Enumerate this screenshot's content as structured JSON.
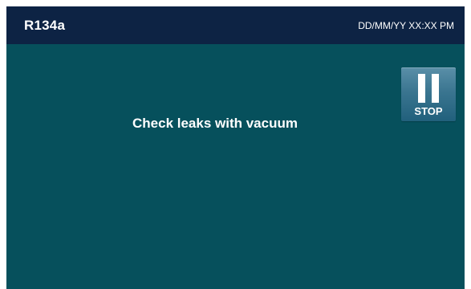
{
  "header": {
    "title": "R134a",
    "datetime": "DD/MM/YY XX:XX PM"
  },
  "main": {
    "message": "Check leaks with vacuum"
  },
  "stop_button": {
    "icon": "pause-icon",
    "label": "STOP"
  },
  "colors": {
    "header_background": "#0d2344",
    "screen_background": "#06505c",
    "button_background": "#3a7590",
    "text": "#ffffff"
  }
}
